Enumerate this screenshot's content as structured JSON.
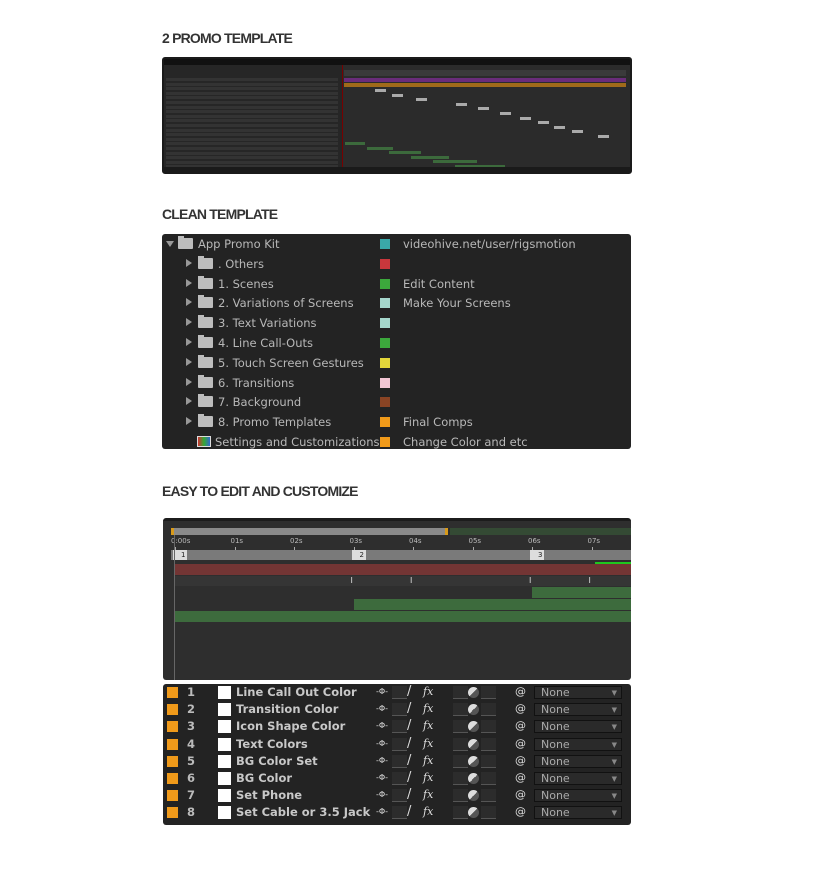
{
  "headings": {
    "promo": "2 PROMO TEMPLATE",
    "clean": "CLEAN TEMPLATE",
    "easy": "EASY TO EDIT AND CUSTOMIZE"
  },
  "project": {
    "items": [
      {
        "name": "App Promo Kit",
        "color": "#3aa8a8",
        "comment": "videohive.net/user/rigsmotion",
        "type": "folder",
        "open": true,
        "indent": 0
      },
      {
        "name": ". Others",
        "color": "#c8373c",
        "comment": "",
        "type": "folder",
        "indent": 1
      },
      {
        "name": "1. Scenes",
        "color": "#3ca83c",
        "comment": "Edit Content",
        "type": "folder",
        "indent": 1
      },
      {
        "name": "2. Variations of Screens",
        "color": "#a6d8cc",
        "comment": "Make Your Screens",
        "type": "folder",
        "indent": 1
      },
      {
        "name": "3. Text Variations",
        "color": "#a6d8cc",
        "comment": "",
        "type": "folder",
        "indent": 1
      },
      {
        "name": "4. Line Call-Outs",
        "color": "#3ca83c",
        "comment": "",
        "type": "folder",
        "indent": 1
      },
      {
        "name": "5. Touch Screen Gestures",
        "color": "#e2d63a",
        "comment": "",
        "type": "folder",
        "indent": 1
      },
      {
        "name": "6. Transitions",
        "color": "#f2c6d4",
        "comment": "",
        "type": "folder",
        "indent": 1
      },
      {
        "name": "7. Background",
        "color": "#8a4424",
        "comment": "",
        "type": "folder",
        "indent": 1
      },
      {
        "name": "8. Promo Templates",
        "color": "#f09a1a",
        "comment": "Final Comps",
        "type": "folder",
        "indent": 1
      },
      {
        "name": "Settings and Customizations",
        "color": "#f09a1a",
        "comment": "Change Color and etc",
        "type": "comp",
        "indent": 1
      }
    ]
  },
  "timeline": {
    "ticks": [
      "0:00s",
      "01s",
      "02s",
      "03s",
      "04s",
      "05s",
      "06s",
      "07s"
    ],
    "markers": [
      "1",
      "2",
      "3"
    ]
  },
  "layers": {
    "mode": "None",
    "rows": [
      {
        "num": "1",
        "name": "Line Call Out Color"
      },
      {
        "num": "2",
        "name": "Transition Color"
      },
      {
        "num": "3",
        "name": "Icon Shape Color"
      },
      {
        "num": "4",
        "name": "Text Colors"
      },
      {
        "num": "5",
        "name": "BG Color Set"
      },
      {
        "num": "6",
        "name": "BG Color"
      },
      {
        "num": "7",
        "name": "Set Phone"
      },
      {
        "num": "8",
        "name": "Set Cable or 3.5 Jack"
      }
    ]
  }
}
